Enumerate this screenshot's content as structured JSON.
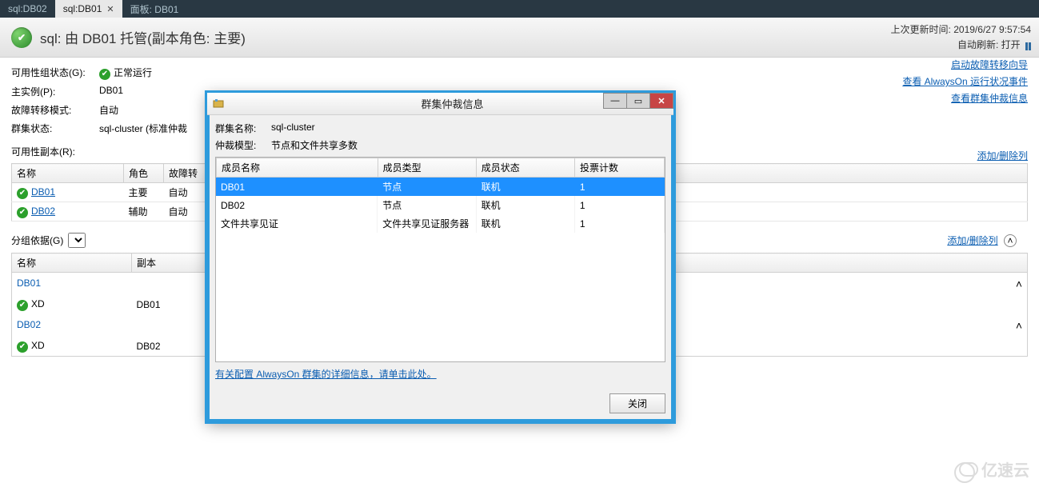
{
  "tabs": [
    {
      "label": "sql:DB02"
    },
    {
      "label": "sql:DB01",
      "active": true
    },
    {
      "label": "面板: DB01"
    }
  ],
  "header": {
    "title": "sql: 由 DB01 托管(副本角色: 主要)",
    "last_update_label": "上次更新时间:",
    "last_update_value": "2019/6/27 9:57:54",
    "auto_refresh_label": "自动刷新:",
    "auto_refresh_value": "打开"
  },
  "info": {
    "avail_state_label": "可用性组状态(G):",
    "avail_state_value": "正常运行",
    "primary_label": "主实例(P):",
    "primary_value": "DB01",
    "failover_mode_label": "故障转移模式:",
    "failover_mode_value": "自动",
    "cluster_state_label": "群集状态:",
    "cluster_state_value": "sql-cluster (标准仲裁"
  },
  "right_links": {
    "l1": "启动故障转移向导",
    "l2": "查看 AlwaysOn 运行状况事件",
    "l3": "查看群集仲裁信息"
  },
  "replicas": {
    "section_label": "可用性副本(R):",
    "add_remove": "添加/删除列",
    "cols": {
      "name": "名称",
      "role": "角色",
      "failover": "故障转"
    },
    "rows": [
      {
        "name": "DB01",
        "role": "主要",
        "failover": "自动"
      },
      {
        "name": "DB02",
        "role": "辅助",
        "failover": "自动"
      }
    ]
  },
  "groupby": {
    "label": "分组依据(G)",
    "add_remove": "添加/删除列",
    "cols": {
      "name": "名称",
      "replica": "副本"
    },
    "groups": [
      {
        "header": "DB01",
        "rows": [
          {
            "name": "XD",
            "replica": "DB01"
          }
        ]
      },
      {
        "header": "DB02",
        "rows": [
          {
            "name": "XD",
            "replica": "DB02"
          }
        ]
      }
    ]
  },
  "modal": {
    "title": "群集仲裁信息",
    "cluster_name_label": "群集名称:",
    "cluster_name_value": "sql-cluster",
    "quorum_model_label": "仲裁模型:",
    "quorum_model_value": "节点和文件共享多数",
    "cols": {
      "member_name": "成员名称",
      "member_type": "成员类型",
      "member_state": "成员状态",
      "vote_count": "投票计数"
    },
    "rows": [
      {
        "name": "DB01",
        "type": "节点",
        "state": "联机",
        "vote": "1",
        "selected": true
      },
      {
        "name": "DB02",
        "type": "节点",
        "state": "联机",
        "vote": "1"
      },
      {
        "name": "文件共享见证",
        "type": "文件共享见证服务器",
        "state": "联机",
        "vote": "1"
      }
    ],
    "footer_link": "有关配置 AlwaysOn 群集的详细信息，请单击此处。",
    "close_btn": "关闭"
  },
  "watermark": "亿速云"
}
